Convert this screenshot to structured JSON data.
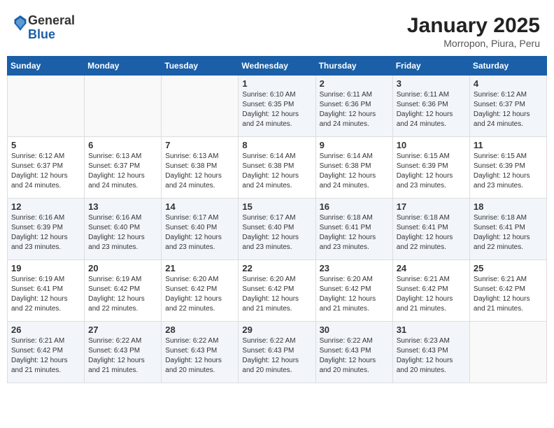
{
  "header": {
    "logo_general": "General",
    "logo_blue": "Blue",
    "month_title": "January 2025",
    "location": "Morropon, Piura, Peru"
  },
  "weekdays": [
    "Sunday",
    "Monday",
    "Tuesday",
    "Wednesday",
    "Thursday",
    "Friday",
    "Saturday"
  ],
  "weeks": [
    [
      {
        "day": "",
        "sunrise": "",
        "sunset": "",
        "daylight": ""
      },
      {
        "day": "",
        "sunrise": "",
        "sunset": "",
        "daylight": ""
      },
      {
        "day": "",
        "sunrise": "",
        "sunset": "",
        "daylight": ""
      },
      {
        "day": "1",
        "sunrise": "Sunrise: 6:10 AM",
        "sunset": "Sunset: 6:35 PM",
        "daylight": "Daylight: 12 hours and 24 minutes."
      },
      {
        "day": "2",
        "sunrise": "Sunrise: 6:11 AM",
        "sunset": "Sunset: 6:36 PM",
        "daylight": "Daylight: 12 hours and 24 minutes."
      },
      {
        "day": "3",
        "sunrise": "Sunrise: 6:11 AM",
        "sunset": "Sunset: 6:36 PM",
        "daylight": "Daylight: 12 hours and 24 minutes."
      },
      {
        "day": "4",
        "sunrise": "Sunrise: 6:12 AM",
        "sunset": "Sunset: 6:37 PM",
        "daylight": "Daylight: 12 hours and 24 minutes."
      }
    ],
    [
      {
        "day": "5",
        "sunrise": "Sunrise: 6:12 AM",
        "sunset": "Sunset: 6:37 PM",
        "daylight": "Daylight: 12 hours and 24 minutes."
      },
      {
        "day": "6",
        "sunrise": "Sunrise: 6:13 AM",
        "sunset": "Sunset: 6:37 PM",
        "daylight": "Daylight: 12 hours and 24 minutes."
      },
      {
        "day": "7",
        "sunrise": "Sunrise: 6:13 AM",
        "sunset": "Sunset: 6:38 PM",
        "daylight": "Daylight: 12 hours and 24 minutes."
      },
      {
        "day": "8",
        "sunrise": "Sunrise: 6:14 AM",
        "sunset": "Sunset: 6:38 PM",
        "daylight": "Daylight: 12 hours and 24 minutes."
      },
      {
        "day": "9",
        "sunrise": "Sunrise: 6:14 AM",
        "sunset": "Sunset: 6:38 PM",
        "daylight": "Daylight: 12 hours and 24 minutes."
      },
      {
        "day": "10",
        "sunrise": "Sunrise: 6:15 AM",
        "sunset": "Sunset: 6:39 PM",
        "daylight": "Daylight: 12 hours and 23 minutes."
      },
      {
        "day": "11",
        "sunrise": "Sunrise: 6:15 AM",
        "sunset": "Sunset: 6:39 PM",
        "daylight": "Daylight: 12 hours and 23 minutes."
      }
    ],
    [
      {
        "day": "12",
        "sunrise": "Sunrise: 6:16 AM",
        "sunset": "Sunset: 6:39 PM",
        "daylight": "Daylight: 12 hours and 23 minutes."
      },
      {
        "day": "13",
        "sunrise": "Sunrise: 6:16 AM",
        "sunset": "Sunset: 6:40 PM",
        "daylight": "Daylight: 12 hours and 23 minutes."
      },
      {
        "day": "14",
        "sunrise": "Sunrise: 6:17 AM",
        "sunset": "Sunset: 6:40 PM",
        "daylight": "Daylight: 12 hours and 23 minutes."
      },
      {
        "day": "15",
        "sunrise": "Sunrise: 6:17 AM",
        "sunset": "Sunset: 6:40 PM",
        "daylight": "Daylight: 12 hours and 23 minutes."
      },
      {
        "day": "16",
        "sunrise": "Sunrise: 6:18 AM",
        "sunset": "Sunset: 6:41 PM",
        "daylight": "Daylight: 12 hours and 23 minutes."
      },
      {
        "day": "17",
        "sunrise": "Sunrise: 6:18 AM",
        "sunset": "Sunset: 6:41 PM",
        "daylight": "Daylight: 12 hours and 22 minutes."
      },
      {
        "day": "18",
        "sunrise": "Sunrise: 6:18 AM",
        "sunset": "Sunset: 6:41 PM",
        "daylight": "Daylight: 12 hours and 22 minutes."
      }
    ],
    [
      {
        "day": "19",
        "sunrise": "Sunrise: 6:19 AM",
        "sunset": "Sunset: 6:41 PM",
        "daylight": "Daylight: 12 hours and 22 minutes."
      },
      {
        "day": "20",
        "sunrise": "Sunrise: 6:19 AM",
        "sunset": "Sunset: 6:42 PM",
        "daylight": "Daylight: 12 hours and 22 minutes."
      },
      {
        "day": "21",
        "sunrise": "Sunrise: 6:20 AM",
        "sunset": "Sunset: 6:42 PM",
        "daylight": "Daylight: 12 hours and 22 minutes."
      },
      {
        "day": "22",
        "sunrise": "Sunrise: 6:20 AM",
        "sunset": "Sunset: 6:42 PM",
        "daylight": "Daylight: 12 hours and 21 minutes."
      },
      {
        "day": "23",
        "sunrise": "Sunrise: 6:20 AM",
        "sunset": "Sunset: 6:42 PM",
        "daylight": "Daylight: 12 hours and 21 minutes."
      },
      {
        "day": "24",
        "sunrise": "Sunrise: 6:21 AM",
        "sunset": "Sunset: 6:42 PM",
        "daylight": "Daylight: 12 hours and 21 minutes."
      },
      {
        "day": "25",
        "sunrise": "Sunrise: 6:21 AM",
        "sunset": "Sunset: 6:42 PM",
        "daylight": "Daylight: 12 hours and 21 minutes."
      }
    ],
    [
      {
        "day": "26",
        "sunrise": "Sunrise: 6:21 AM",
        "sunset": "Sunset: 6:42 PM",
        "daylight": "Daylight: 12 hours and 21 minutes."
      },
      {
        "day": "27",
        "sunrise": "Sunrise: 6:22 AM",
        "sunset": "Sunset: 6:43 PM",
        "daylight": "Daylight: 12 hours and 21 minutes."
      },
      {
        "day": "28",
        "sunrise": "Sunrise: 6:22 AM",
        "sunset": "Sunset: 6:43 PM",
        "daylight": "Daylight: 12 hours and 20 minutes."
      },
      {
        "day": "29",
        "sunrise": "Sunrise: 6:22 AM",
        "sunset": "Sunset: 6:43 PM",
        "daylight": "Daylight: 12 hours and 20 minutes."
      },
      {
        "day": "30",
        "sunrise": "Sunrise: 6:22 AM",
        "sunset": "Sunset: 6:43 PM",
        "daylight": "Daylight: 12 hours and 20 minutes."
      },
      {
        "day": "31",
        "sunrise": "Sunrise: 6:23 AM",
        "sunset": "Sunset: 6:43 PM",
        "daylight": "Daylight: 12 hours and 20 minutes."
      },
      {
        "day": "",
        "sunrise": "",
        "sunset": "",
        "daylight": ""
      }
    ]
  ]
}
